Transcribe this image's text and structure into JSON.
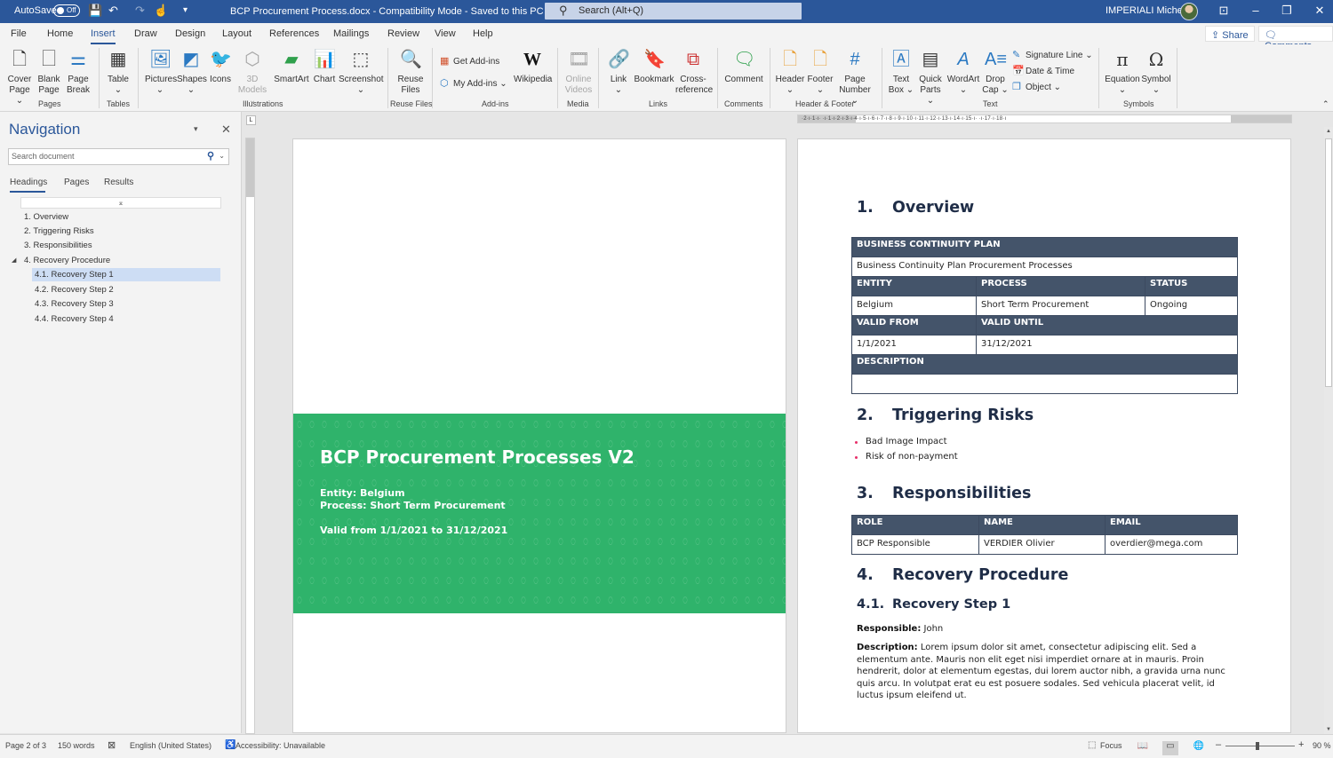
{
  "titlebar": {
    "autosave_label": "AutoSave",
    "autosave_state": "Off",
    "document_title": "BCP Procurement Process.docx  -  Compatibility Mode  -  Saved to this PC  ⌄",
    "search_placeholder": "Search (Alt+Q)",
    "user_name": "IMPERIALI Michele",
    "qat": {
      "save_icon": "💾",
      "undo_icon": "↶",
      "redo_icon": "↷",
      "touch_icon": "☝",
      "more_icon": "⌄",
      "customize_icon": "▾"
    },
    "window_buttons": {
      "ribbon_display": "⊡",
      "minimize": "–",
      "restore": "❐",
      "close": "✕"
    }
  },
  "menu": {
    "tabs": [
      "File",
      "Home",
      "Insert",
      "Draw",
      "Design",
      "Layout",
      "References",
      "Mailings",
      "Review",
      "View",
      "Help"
    ],
    "active_tab": "Insert",
    "share_label": "Share",
    "comments_label": "Comments"
  },
  "ribbon": {
    "groups": {
      "pages": "Pages",
      "tables": "Tables",
      "illustrations": "Illustrations",
      "reuse_files": "Reuse Files",
      "addins": "Add-ins",
      "media": "Media",
      "links": "Links",
      "comments": "Comments",
      "header_footer": "Header & Footer",
      "text": "Text",
      "symbols": "Symbols"
    },
    "buttons": {
      "cover_page": "Cover Page ⌄",
      "blank_page": "Blank Page",
      "page_break": "Page Break",
      "table": "Table ⌄",
      "pictures": "Pictures ⌄",
      "shapes": "Shapes ⌄",
      "icons": "Icons",
      "models_3d": "3D Models ⌄",
      "smartart": "SmartArt",
      "chart": "Chart",
      "screenshot": "Screenshot ⌄",
      "reuse_files": "Reuse Files",
      "get_addins": "Get Add-ins",
      "my_addins": "My Add-ins  ⌄",
      "wikipedia": "Wikipedia",
      "online_videos": "Online Videos",
      "link": "Link ⌄",
      "bookmark": "Bookmark",
      "cross_reference": "Cross-reference",
      "comment": "Comment",
      "header": "Header ⌄",
      "footer": "Footer ⌄",
      "page_number": "Page Number ⌄",
      "text_box": "Text Box ⌄",
      "quick_parts": "Quick Parts ⌄",
      "wordart": "WordArt ⌄",
      "drop_cap": "Drop Cap ⌄",
      "signature_line": "Signature Line  ⌄",
      "date_time": "Date & Time",
      "object": "Object  ⌄",
      "equation": "Equation ⌄",
      "symbol": "Symbol ⌄"
    }
  },
  "navigation": {
    "title": "Navigation",
    "search_placeholder": "Search document",
    "tabs": [
      "Headings",
      "Pages",
      "Results"
    ],
    "active_tab": "Headings",
    "headings": [
      {
        "label": "1. Overview",
        "level": 1
      },
      {
        "label": "2. Triggering Risks",
        "level": 1
      },
      {
        "label": "3. Responsibilities",
        "level": 1
      },
      {
        "label": "4. Recovery Procedure",
        "level": 1
      },
      {
        "label": "4.1. Recovery Step 1",
        "level": 2,
        "selected": true
      },
      {
        "label": "4.2. Recovery Step 2",
        "level": 2
      },
      {
        "label": "4.3. Recovery Step 3",
        "level": 2
      },
      {
        "label": "4.4. Recovery Step 4",
        "level": 2
      }
    ]
  },
  "ruler": {
    "horizontal_ticks": "·2·ı·1·ı·  ·ı·1·ı·2·ı·3·ı·4·ı·5·ı·6·ı·7·ı·8·ı·9·ı·10·ı·11·ı·12·ı·13·ı·14·ı·15·ı·  ·ı·17·ı·18·ı"
  },
  "cover": {
    "title": "BCP Procurement Processes V2",
    "entity_line": "Entity: Belgium",
    "process_line": "Process: Short Term Procurement",
    "valid_line": "Valid from 1/1/2021 to 31/12/2021",
    "color": "#2fb36b"
  },
  "document": {
    "sections": {
      "overview": {
        "num": "1.",
        "title": "Overview"
      },
      "risks": {
        "num": "2.",
        "title": "Triggering Risks"
      },
      "responsibilities": {
        "num": "3.",
        "title": "Responsibilities"
      },
      "recovery": {
        "num": "4.",
        "title": "Recovery Procedure"
      },
      "step1": {
        "num": "4.1.",
        "title": "Recovery Step 1"
      }
    },
    "bcp_table": {
      "header": "BUSINESS CONTINUITY PLAN",
      "plan_name": "Business Continuity Plan Procurement Processes",
      "entity_header": "ENTITY",
      "process_header": "PROCESS",
      "status_header": "STATUS",
      "entity": "Belgium",
      "process": "Short Term Procurement",
      "status": "Ongoing",
      "valid_from_header": "VALID FROM",
      "valid_until_header": "VALID UNTIL",
      "valid_from": "1/1/2021",
      "valid_until": "31/12/2021",
      "description_header": "DESCRIPTION",
      "description": ""
    },
    "risks": [
      "Bad Image Impact",
      "Risk of non-payment"
    ],
    "resp_table": {
      "headers": [
        "ROLE",
        "NAME",
        "EMAIL"
      ],
      "rows": [
        [
          "BCP Responsible",
          "VERDIER Olivier",
          "overdier@mega.com"
        ]
      ]
    },
    "step1": {
      "responsible_label": "Responsible:",
      "responsible": " John",
      "description_label": "Description:",
      "description": " Lorem ipsum dolor sit amet, consectetur adipiscing elit. Sed a elementum ante. Mauris non elit eget nisi imperdiet ornare at in mauris. Proin hendrerit, dolor at elementum egestas, dui lorem auctor nibh, a gravida urna nunc quis arcu. In volutpat erat eu est posuere sodales. Sed vehicula placerat velit, id luctus ipsum eleifend ut."
    },
    "header_color": "#44546a",
    "heading_color": "#1f2d47",
    "bullet_color": "#e8306a"
  },
  "statusbar": {
    "page": "Page 2 of 3",
    "words": "150 words",
    "language": "English (United States)",
    "accessibility": "Accessibility: Unavailable",
    "focus": "Focus",
    "zoom_level": "90 %",
    "zoom_percent": 90
  }
}
